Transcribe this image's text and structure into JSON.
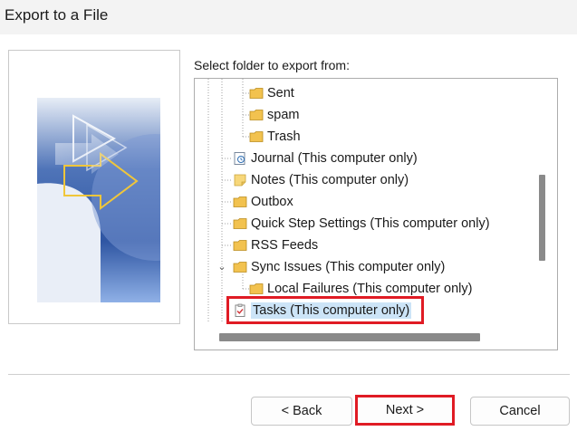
{
  "window": {
    "title": "Export to a File"
  },
  "folder_label": "Select folder to export from:",
  "tree": {
    "items": [
      {
        "label": "Sent",
        "icon": "folder-icon"
      },
      {
        "label": "spam",
        "icon": "folder-icon"
      },
      {
        "label": "Trash",
        "icon": "folder-icon"
      },
      {
        "label": "Journal (This computer only)",
        "icon": "journal-icon"
      },
      {
        "label": "Notes (This computer only)",
        "icon": "notes-icon"
      },
      {
        "label": "Outbox",
        "icon": "folder-icon"
      },
      {
        "label": "Quick Step Settings (This computer only)",
        "icon": "folder-icon"
      },
      {
        "label": "RSS Feeds",
        "icon": "folder-icon"
      },
      {
        "label": "Sync Issues (This computer only)",
        "icon": "folder-icon",
        "expanded": true
      },
      {
        "label": "Local Failures (This computer only)",
        "icon": "folder-icon"
      },
      {
        "label": "Tasks (This computer only)",
        "icon": "tasks-icon",
        "selected": true
      }
    ]
  },
  "buttons": {
    "back": "< Back",
    "next": "Next >",
    "cancel": "Cancel"
  },
  "colors": {
    "highlight": "#e01b24",
    "selection": "#cce4f7",
    "folder": "#f2c24f"
  }
}
